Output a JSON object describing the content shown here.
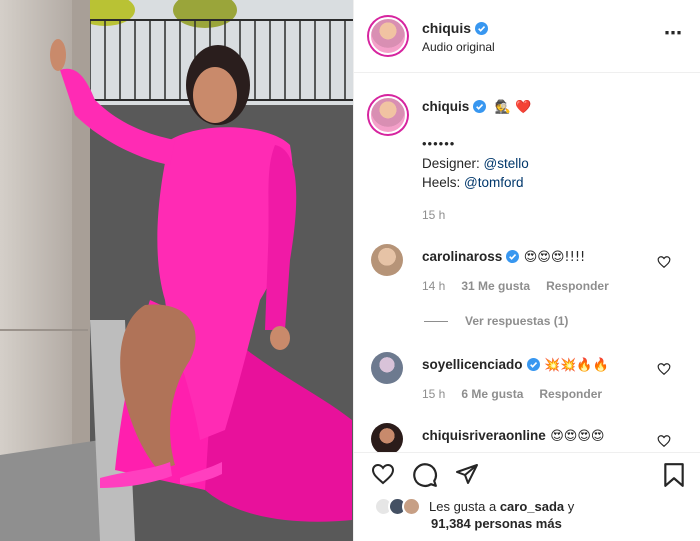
{
  "header": {
    "username": "chiquis",
    "subtitle": "Audio original",
    "more_icon": "more-horizontal-icon"
  },
  "caption": {
    "username": "chiquis",
    "emojis": "🕵 ❤️",
    "dots": "••••••",
    "line1_label": "Designer: ",
    "line1_mention": "@stello",
    "line2_label": "Heels: ",
    "line2_mention": "@tomford",
    "time": "15 h"
  },
  "comments": [
    {
      "username": "carolinaross",
      "text": "😍😍😍!!!!",
      "time": "14 h",
      "likes": "31 Me gusta",
      "reply": "Responder",
      "view_replies": "Ver respuestas (1)"
    },
    {
      "username": "soyellicenciado",
      "text": "💥💥🔥🔥",
      "time": "15 h",
      "likes": "6 Me gusta",
      "reply": "Responder"
    },
    {
      "username": "chiquisriveraonline",
      "text": "😍😍😍😍"
    }
  ],
  "likes": {
    "prefix": "Les gusta a ",
    "user": "caro_sada",
    "suffix": " y",
    "count": "91,384 personas más"
  },
  "colors": {
    "dress": "#ff1fae",
    "verified": "#3897f0",
    "avatar_ring": "#d6249f",
    "link": "#00376b"
  }
}
